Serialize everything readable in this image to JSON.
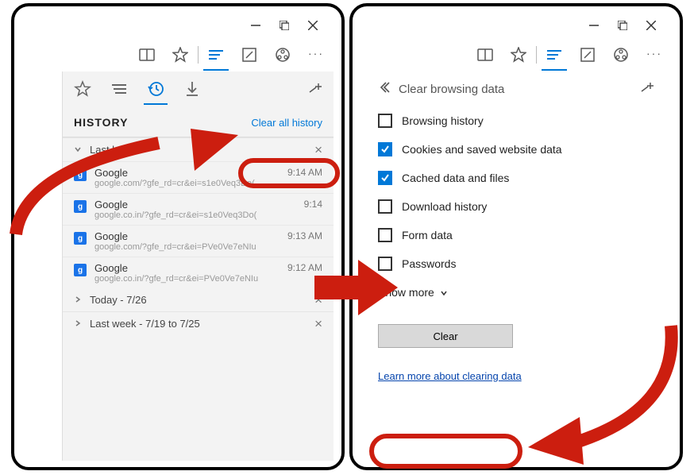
{
  "leftPanel": {
    "historyTitle": "HISTORY",
    "clearAll": "Clear all history",
    "section": "Last hour",
    "entries": [
      {
        "title": "Google",
        "url": "google.com/?gfe_rd=cr&ei=s1e0Veq3Do(",
        "time": "9:14 AM"
      },
      {
        "title": "Google",
        "url": "google.co.in/?gfe_rd=cr&ei=s1e0Veq3Do(",
        "time": "9:14"
      },
      {
        "title": "Google",
        "url": "google.com/?gfe_rd=cr&ei=PVe0Ve7eNIu",
        "time": "9:13 AM"
      },
      {
        "title": "Google",
        "url": "google.co.in/?gfe_rd=cr&ei=PVe0Ve7eNIu",
        "time": "9:12 AM"
      }
    ],
    "groups": [
      {
        "label": "Today - 7/26"
      },
      {
        "label": "Last week - 7/19 to 7/25"
      }
    ],
    "faviconLetter": "g"
  },
  "rightPanel": {
    "title": "Clear browsing data",
    "options": [
      {
        "label": "Browsing history",
        "checked": false
      },
      {
        "label": "Cookies and saved website data",
        "checked": true
      },
      {
        "label": "Cached data and files",
        "checked": true
      },
      {
        "label": "Download history",
        "checked": false
      },
      {
        "label": "Form data",
        "checked": false
      },
      {
        "label": "Passwords",
        "checked": false
      }
    ],
    "showMore": "Show more",
    "clearBtn": "Clear",
    "learn": "Learn more about clearing data"
  }
}
